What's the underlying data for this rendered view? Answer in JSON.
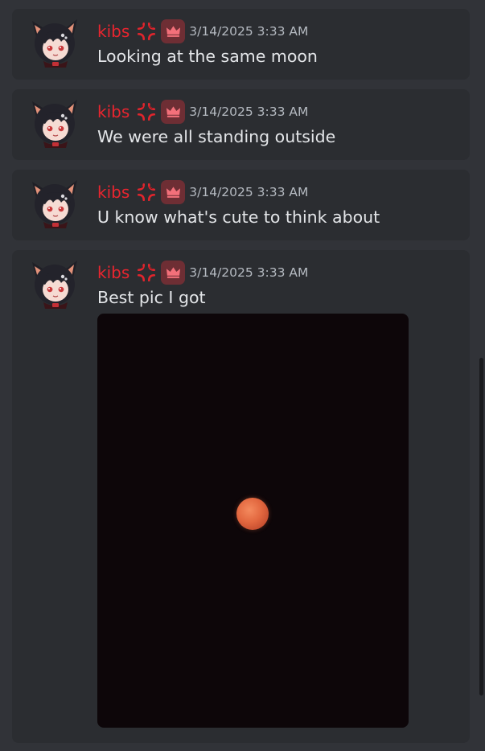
{
  "messages": [
    {
      "username": "kibs",
      "timestamp": "3/14/2025 3:33 AM",
      "text": "Looking at the same moon"
    },
    {
      "username": "kibs",
      "timestamp": "3/14/2025 3:33 AM",
      "text": "We were all standing outside"
    },
    {
      "username": "kibs",
      "timestamp": "3/14/2025 3:33 AM",
      "text": "U know what's cute to think about"
    },
    {
      "username": "kibs",
      "timestamp": "3/14/2025 3:33 AM",
      "text": "Best pic I got",
      "attachment": "moon-photo"
    }
  ],
  "colors": {
    "background": "#313338",
    "message_background": "#2b2d31",
    "username": "#e9252f",
    "timestamp": "#b5bac1",
    "text": "#e3e5e8",
    "role_badge": "#6e2e34",
    "photo_sky": "#0d0609",
    "moon": "#e2673f"
  },
  "icons": {
    "avatar": "cat-ear-anime-avatar",
    "anger": "anger-symbol-icon",
    "role": "crown-icon"
  }
}
